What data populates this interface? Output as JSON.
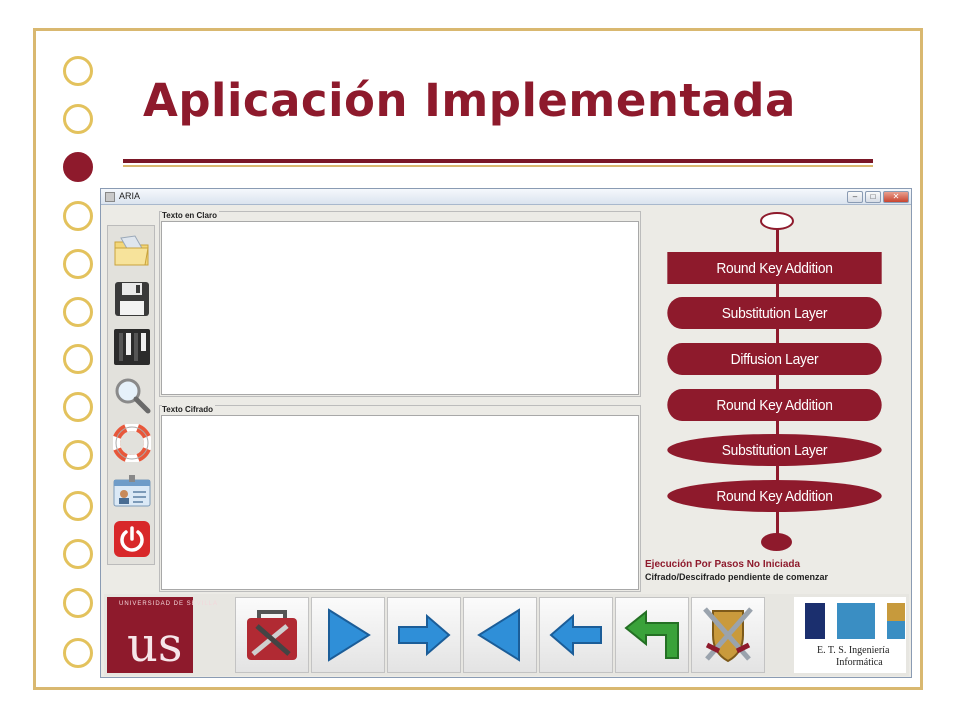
{
  "slide": {
    "title": "Aplicación Implementada"
  },
  "window": {
    "title": "ARIA",
    "buttons": {
      "minimize": "–",
      "maximize": "□",
      "close": "✕"
    }
  },
  "panels": {
    "plain_label": "Texto en Claro",
    "cipher_label": "Texto Cifrado"
  },
  "sidebar_icons": [
    "open-folder-icon",
    "save-floppy-icon",
    "key-panel-icon",
    "search-magnifier-icon",
    "help-lifebuoy-icon",
    "id-card-icon",
    "power-exit-icon"
  ],
  "flow": {
    "steps": [
      {
        "label": "Round Key Addition",
        "shape": "rect"
      },
      {
        "label": "Substitution Layer",
        "shape": "pill"
      },
      {
        "label": "Diffusion Layer",
        "shape": "pill"
      },
      {
        "label": "Round Key Addition",
        "shape": "pill"
      },
      {
        "label": "Substitution Layer",
        "shape": "ellipse"
      },
      {
        "label": "Round Key Addition",
        "shape": "ellipse"
      }
    ]
  },
  "status": {
    "line1": "Ejecución Por Pasos No Iniciada",
    "line2": "Cifrado/Descifrado pendiente de comenzar"
  },
  "bottom": {
    "university_ring": "UNIVERSIDAD DE SEVILLA",
    "university_mark": "us",
    "toolbar_icons": [
      "toolbox-icon",
      "play-right-triangle-icon",
      "arrow-right-icon",
      "play-left-triangle-icon",
      "arrow-left-icon",
      "return-arrow-icon",
      "crossed-swords-shield-icon"
    ],
    "school_line1": "E. T. S. Ingeniería",
    "school_line2": "Informática"
  },
  "colors": {
    "brand": "#8e1a2c",
    "gold": "#d9b870",
    "blue_arrow": "#2f8fd8",
    "green_arrow": "#3aa23a"
  }
}
